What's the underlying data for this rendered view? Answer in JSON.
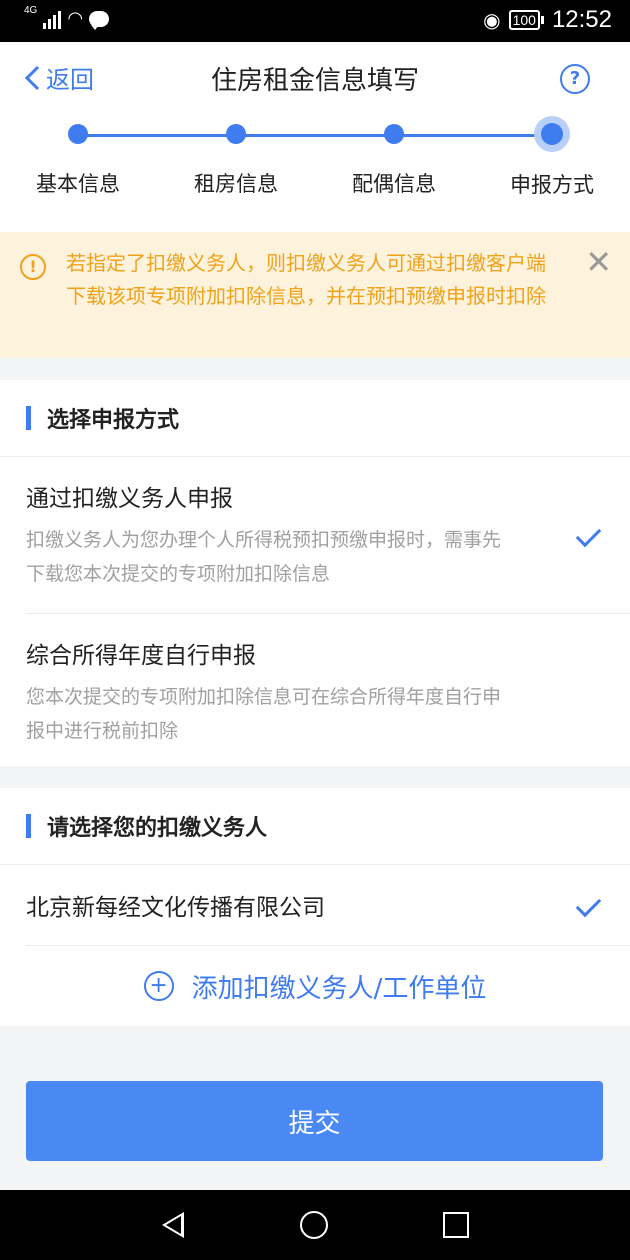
{
  "status_bar": {
    "network": "4G",
    "battery": "100",
    "time": "12:52"
  },
  "header": {
    "back_label": "返回",
    "title": "住房租金信息填写"
  },
  "steps": [
    {
      "label": "基本信息"
    },
    {
      "label": "租房信息"
    },
    {
      "label": "配偶信息"
    },
    {
      "label": "申报方式"
    }
  ],
  "notice": {
    "text": "若指定了扣缴义务人，则扣缴义务人可通过扣缴客户端下载该项专项附加扣除信息，并在预扣预缴申报时扣除"
  },
  "report_method": {
    "title": "选择申报方式",
    "options": [
      {
        "label": "通过扣缴义务人申报",
        "description": "扣缴义务人为您办理个人所得税预扣预缴申报时，需事先下载您本次提交的专项附加扣除信息",
        "selected": true
      },
      {
        "label": "综合所得年度自行申报",
        "description": "您本次提交的专项附加扣除信息可在综合所得年度自行申报中进行税前扣除",
        "selected": false
      }
    ]
  },
  "withholder": {
    "title": "请选择您的扣缴义务人",
    "company": "北京新每经文化传播有限公司",
    "add_label": "添加扣缴义务人/工作单位"
  },
  "submit_label": "提交",
  "colors": {
    "accent": "#3f7cf0",
    "notice_bg": "#fdf3dc",
    "notice_text": "#f0a21b"
  }
}
